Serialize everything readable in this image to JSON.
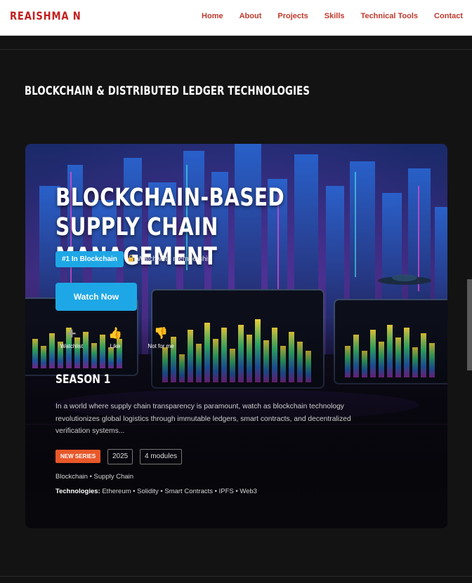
{
  "nav": {
    "brand": "REAISHMA N",
    "links": [
      "Home",
      "About",
      "Projects",
      "Skills",
      "Technical Tools",
      "Contact"
    ]
  },
  "section": {
    "title": "BLOCKCHAIN & DISTRIBUTED LEDGER TECHNOLOGIES"
  },
  "card": {
    "title": "BLOCKCHAIN-BASED SUPPLY CHAIN MANAGEMENT",
    "rank_badge": "#1 In Blockchain",
    "membership": "Watch with membership",
    "watch_button": "Watch Now",
    "actions": {
      "watchlist": "Watchlist",
      "like": "Like",
      "not_for_me": "Not for me"
    },
    "season": "SEASON 1",
    "description": "In a world where supply chain transparency is paramount, watch as blockchain technology revolutionizes global logistics through immutable ledgers, smart contracts, and decentralized verification systems...",
    "tag_new": "NEW SERIES",
    "year": "2025",
    "modules": "4 modules",
    "genres": "Blockchain • Supply Chain",
    "technologies_label": "Technologies:",
    "technologies": " Ethereum • Solidity • Smart Contracts • IPFS • Web3"
  },
  "colors": {
    "brand": "#c21e1e",
    "nav_link": "#c0392b",
    "accent": "#1ea7e6",
    "new_tag": "#e8582a",
    "background": "#131313"
  },
  "icons": {
    "watchlist": "plus-icon",
    "like": "thumbs-up-icon",
    "not_for_me": "thumbs-down-icon",
    "membership": "lock-icon"
  }
}
